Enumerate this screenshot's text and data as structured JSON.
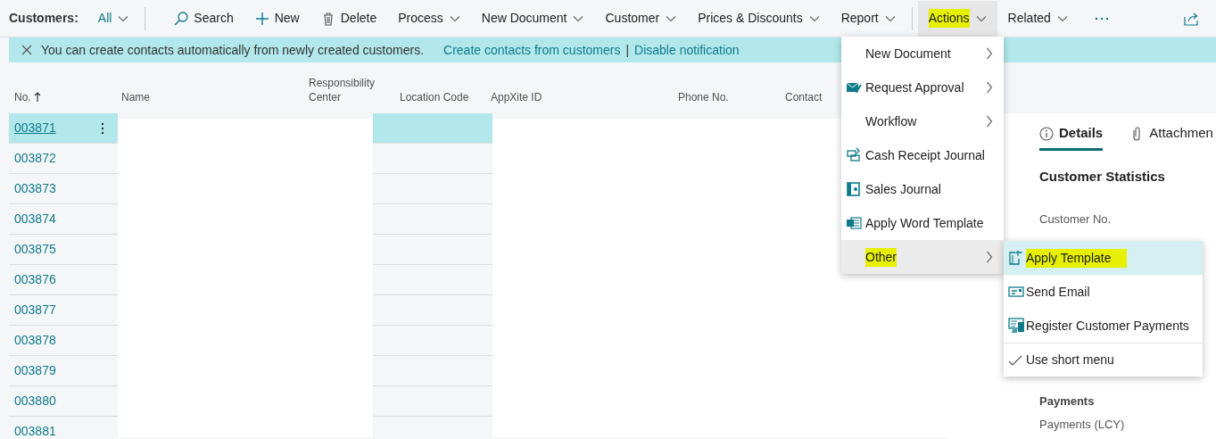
{
  "toolbar": {
    "page_title": "Customers:",
    "view": "All",
    "actions": [
      {
        "label": "Search",
        "kind": "search",
        "selected": false,
        "highlighted": false
      },
      {
        "label": "New",
        "kind": "new",
        "selected": false,
        "highlighted": false
      },
      {
        "label": "Delete",
        "kind": "delete",
        "selected": false,
        "highlighted": false
      },
      {
        "label": "Process",
        "kind": "menu",
        "selected": false,
        "highlighted": false
      },
      {
        "label": "New Document",
        "kind": "menu",
        "selected": false,
        "highlighted": false
      },
      {
        "label": "Customer",
        "kind": "menu",
        "selected": false,
        "highlighted": false
      },
      {
        "label": "Prices & Discounts",
        "kind": "menu",
        "selected": false,
        "highlighted": false
      },
      {
        "label": "Report",
        "kind": "menu",
        "selected": false,
        "highlighted": false
      },
      {
        "label": "Actions",
        "kind": "menu",
        "selected": true,
        "highlighted": true
      },
      {
        "label": "Related",
        "kind": "menu",
        "selected": false,
        "highlighted": false
      }
    ]
  },
  "notification": {
    "message": "You can create contacts automatically from newly created customers.",
    "links": [
      "Create contacts from customers",
      "Disable notification"
    ],
    "separator": "|"
  },
  "table": {
    "columns": [
      {
        "label": "No.",
        "sorted": true
      },
      {
        "label": "Name",
        "sorted": false
      },
      {
        "label": "Responsibility Center",
        "sorted": false
      },
      {
        "label": "Location Code",
        "sorted": false
      },
      {
        "label": "AppXite ID",
        "sorted": false
      },
      {
        "label": "Phone No.",
        "sorted": false
      },
      {
        "label": "Contact",
        "sorted": false
      }
    ],
    "rows": [
      {
        "no": "003871",
        "selected": true
      },
      {
        "no": "003872",
        "selected": false
      },
      {
        "no": "003873",
        "selected": false
      },
      {
        "no": "003874",
        "selected": false
      },
      {
        "no": "003875",
        "selected": false
      },
      {
        "no": "003876",
        "selected": false
      },
      {
        "no": "003877",
        "selected": false
      },
      {
        "no": "003878",
        "selected": false
      },
      {
        "no": "003879",
        "selected": false
      },
      {
        "no": "003880",
        "selected": false
      },
      {
        "no": "003881",
        "selected": false
      }
    ]
  },
  "actions_menu": [
    {
      "label": "New Document",
      "kind": "submenu",
      "selected": false,
      "highlighted": false
    },
    {
      "label": "Request Approval",
      "kind": "submenu",
      "selected": false,
      "highlighted": false
    },
    {
      "label": "Workflow",
      "kind": "submenu",
      "selected": false,
      "highlighted": false
    },
    {
      "label": "Cash Receipt Journal",
      "kind": "command",
      "selected": false,
      "highlighted": false
    },
    {
      "label": "Sales Journal",
      "kind": "command",
      "selected": false,
      "highlighted": false
    },
    {
      "label": "Apply Word Template",
      "kind": "command",
      "selected": false,
      "highlighted": false
    },
    {
      "label": "Other",
      "kind": "submenu",
      "selected": true,
      "highlighted": true
    }
  ],
  "other_submenu": [
    {
      "kind": "command",
      "label": "Apply Template",
      "selected": true,
      "highlighted": true
    },
    {
      "kind": "command",
      "label": "Send Email",
      "selected": false,
      "highlighted": false
    },
    {
      "kind": "command",
      "label": "Register Customer Payments",
      "selected": false,
      "highlighted": false
    },
    {
      "kind": "toggle",
      "label": "Use short menu",
      "checked": true
    }
  ],
  "factbox": {
    "tabs": [
      {
        "label": "Details",
        "selected": true
      },
      {
        "label": "Attachmen",
        "selected": false
      }
    ],
    "heading": "Customer Statistics",
    "fields": [
      "Customer No."
    ],
    "section": "Payments",
    "section_fields": [
      "Payments (LCY)"
    ]
  }
}
